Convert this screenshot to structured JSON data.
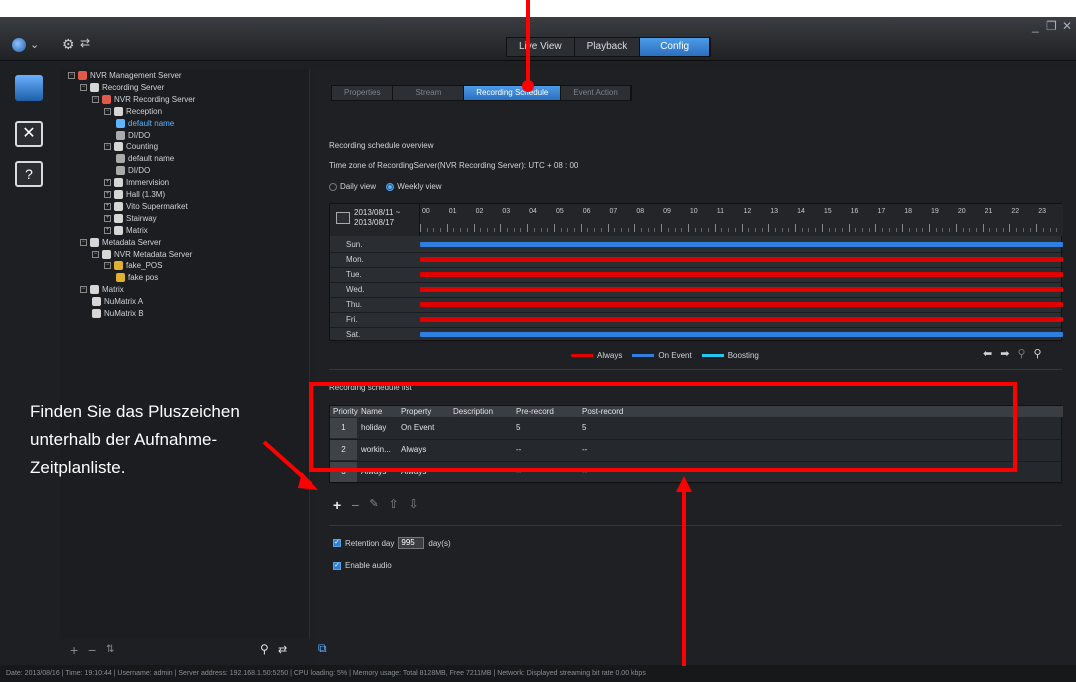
{
  "topbar": {
    "tabs": [
      {
        "label": "Live View",
        "active": false
      },
      {
        "label": "Playback",
        "active": false
      },
      {
        "label": "Config",
        "active": true
      }
    ],
    "window_controls": [
      "_",
      "❐",
      "✕"
    ],
    "icons": [
      "globe-icon",
      "chevron-down-icon",
      "gear-icon",
      "refresh-icon"
    ]
  },
  "rail": {
    "icons": [
      "server-icon",
      "tools-icon",
      "help-icon"
    ]
  },
  "tree": {
    "items": [
      {
        "label": "NVR Management Server",
        "indent": 0,
        "toggle": "−",
        "color": "#e05a4a"
      },
      {
        "label": "Recording Server",
        "indent": 1,
        "toggle": "−",
        "color": "#d6d6d6"
      },
      {
        "label": "NVR Recording Server",
        "indent": 2,
        "toggle": "−",
        "color": "#e05a4a"
      },
      {
        "label": "Reception",
        "indent": 3,
        "toggle": "−",
        "color": "#d6d6d6"
      },
      {
        "label": "default name",
        "indent": 4,
        "toggle": "",
        "color": "#5fb4ff",
        "selected": true
      },
      {
        "label": "DI/DO",
        "indent": 4,
        "toggle": "",
        "color": "#aaaaaa"
      },
      {
        "label": "Counting",
        "indent": 3,
        "toggle": "−",
        "color": "#d6d6d6"
      },
      {
        "label": "default name",
        "indent": 4,
        "toggle": "",
        "color": "#aaaaaa"
      },
      {
        "label": "DI/DO",
        "indent": 4,
        "toggle": "",
        "color": "#aaaaaa"
      },
      {
        "label": "Immervision",
        "indent": 3,
        "toggle": "+",
        "color": "#d6d6d6"
      },
      {
        "label": "Hall (1.3M)",
        "indent": 3,
        "toggle": "+",
        "color": "#d6d6d6"
      },
      {
        "label": "Vito Supermarket",
        "indent": 3,
        "toggle": "+",
        "color": "#d6d6d6"
      },
      {
        "label": "Stairway",
        "indent": 3,
        "toggle": "+",
        "color": "#d6d6d6"
      },
      {
        "label": "Matrix",
        "indent": 3,
        "toggle": "+",
        "color": "#d6d6d6"
      },
      {
        "label": "Metadata Server",
        "indent": 1,
        "toggle": "−",
        "color": "#d6d6d6"
      },
      {
        "label": "NVR Metadata Server",
        "indent": 2,
        "toggle": "−",
        "color": "#d6d6d6"
      },
      {
        "label": "fake_POS",
        "indent": 3,
        "toggle": "−",
        "color": "#e0b030"
      },
      {
        "label": "fake pos",
        "indent": 4,
        "toggle": "",
        "color": "#e0b030"
      },
      {
        "label": "Matrix",
        "indent": 1,
        "toggle": "−",
        "color": "#d6d6d6"
      },
      {
        "label": "NuMatrix A",
        "indent": 2,
        "toggle": "",
        "color": "#d6d6d6"
      },
      {
        "label": "NuMatrix B",
        "indent": 2,
        "toggle": "",
        "color": "#d6d6d6"
      }
    ],
    "footer_icons": [
      "plus-icon",
      "minus-icon",
      "sort-icon",
      "search-icon",
      "refresh-icon"
    ]
  },
  "main": {
    "subtabs": [
      {
        "label": "Properties",
        "active": false
      },
      {
        "label": "Stream",
        "active": false
      },
      {
        "label": "Recording Schedule",
        "active": true
      },
      {
        "label": "Event Action",
        "active": false
      }
    ],
    "overview_title": "Recording schedule overview",
    "timezone": "Time zone of RecordingServer(NVR Recording Server): UTC + 08 : 00",
    "view_daily": "Daily view",
    "view_weekly": "Weekly view",
    "date_range_start": "2013/08/11 ~",
    "date_range_end": "2013/08/17",
    "hours": [
      "00",
      "01",
      "02",
      "03",
      "04",
      "05",
      "06",
      "07",
      "08",
      "09",
      "10",
      "11",
      "12",
      "13",
      "14",
      "15",
      "16",
      "17",
      "18",
      "19",
      "20",
      "21",
      "22",
      "23"
    ],
    "days": [
      {
        "label": "Sun.",
        "mode": "On Event"
      },
      {
        "label": "Mon.",
        "mode": "Always"
      },
      {
        "label": "Tue.",
        "mode": "Always"
      },
      {
        "label": "Wed.",
        "mode": "Always"
      },
      {
        "label": "Thu.",
        "mode": "Always"
      },
      {
        "label": "Fri.",
        "mode": "Always"
      },
      {
        "label": "Sat.",
        "mode": "On Event"
      }
    ],
    "legend": [
      {
        "label": "Always",
        "color": "#e00000"
      },
      {
        "label": "On Event",
        "color": "#2f7fe0"
      },
      {
        "label": "Boosting",
        "color": "#27c6f2"
      }
    ],
    "list_title": "Recording schedule list",
    "columns": [
      "Priority",
      "Name",
      "Property",
      "Description",
      "Pre-record",
      "Post-record"
    ],
    "rows": [
      {
        "priority": "1",
        "name": "holiday",
        "property": "On Event",
        "description": "",
        "pre": "5",
        "post": "5"
      },
      {
        "priority": "2",
        "name": "workin...",
        "property": "Always",
        "description": "",
        "pre": "--",
        "post": "--"
      },
      {
        "priority": "3",
        "name": "Always",
        "property": "Always",
        "description": "",
        "pre": "--",
        "post": "--"
      }
    ],
    "retention_label": "Retention day",
    "retention_value": "995",
    "retention_unit": "day(s)",
    "enable_audio": "Enable audio"
  },
  "statusbar": "Date: 2013/08/16  |  Time: 19:10:44  |  Username: admin  |  Server address: 192.168.1.50:5250  |  CPU loading: 5%  |  Memory usage: Total 8128MB, Free 7211MB  |  Network: Displayed streaming bit rate   0.00 kbps",
  "annotation": {
    "text": "Finden Sie das Pluszeichen unterhalb der Aufnahme-Zeitplanliste.",
    "color": "#ff0000"
  }
}
